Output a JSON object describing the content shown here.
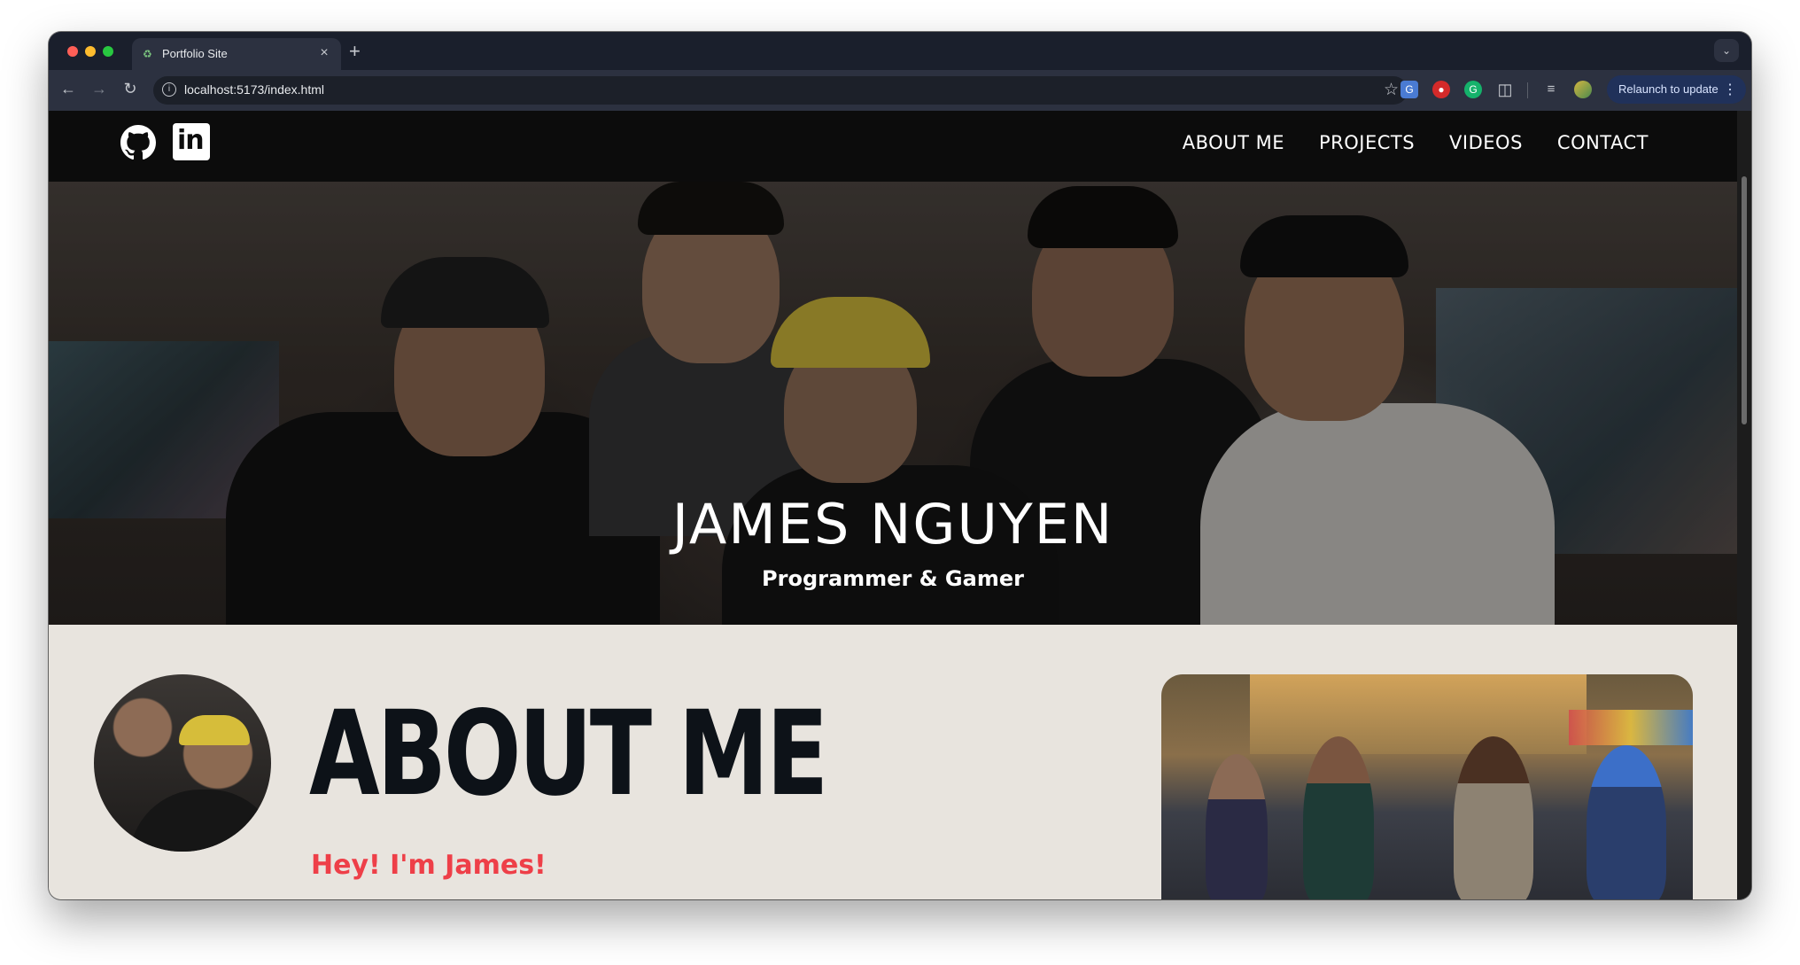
{
  "browser": {
    "tab_title": "Portfolio Site",
    "url": "localhost:5173/index.html",
    "relaunch_label": "Relaunch to update"
  },
  "site": {
    "nav_links": [
      "ABOUT ME",
      "PROJECTS",
      "VIDEOS",
      "CONTACT"
    ],
    "social_icons": [
      "github-icon",
      "linkedin-icon"
    ],
    "linkedin_glyph": "in"
  },
  "hero": {
    "title": "JAMES NGUYEN",
    "subtitle": "Programmer & Gamer"
  },
  "about": {
    "heading": "ABOUT ME",
    "greeting": "Hey! I'm James!"
  },
  "colors": {
    "nav_background": "#0c0c0c",
    "section_background": "#e8e4de",
    "heading_color": "#0d1218",
    "greeting_color": "#ee3f48"
  }
}
